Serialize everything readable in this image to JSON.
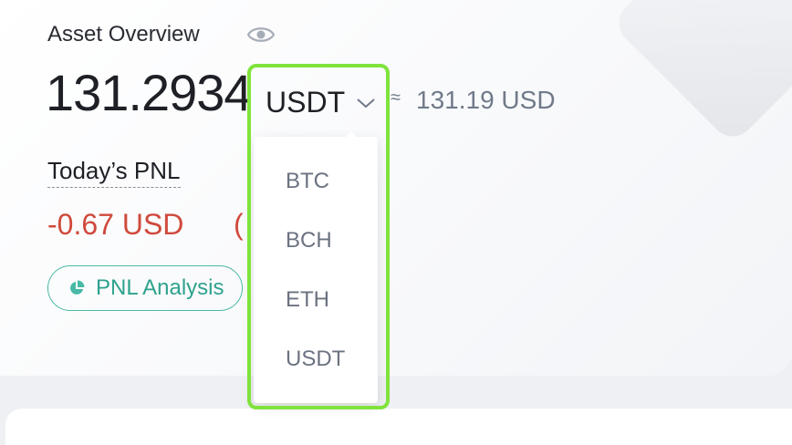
{
  "asset": {
    "title": "Asset Overview",
    "balance": "131.2934",
    "currency": "USDT",
    "approx_symbol": "≈",
    "approx_value": "131.19 USD"
  },
  "pnl": {
    "label": "Today’s PNL",
    "value": "-0.67 USD",
    "percent_open": "(",
    "analysis_button": "PNL Analysis"
  },
  "dropdown": {
    "options": [
      "BTC",
      "BCH",
      "ETH",
      "USDT"
    ]
  },
  "icons": {
    "visibility": "eye-icon",
    "select": "chevron-down-icon",
    "analysis": "pie-chart-icon"
  },
  "colors": {
    "negative": "#cf4a3c",
    "accent": "#2ea28d",
    "highlight": "#7fe33c",
    "muted": "#707a8a"
  }
}
